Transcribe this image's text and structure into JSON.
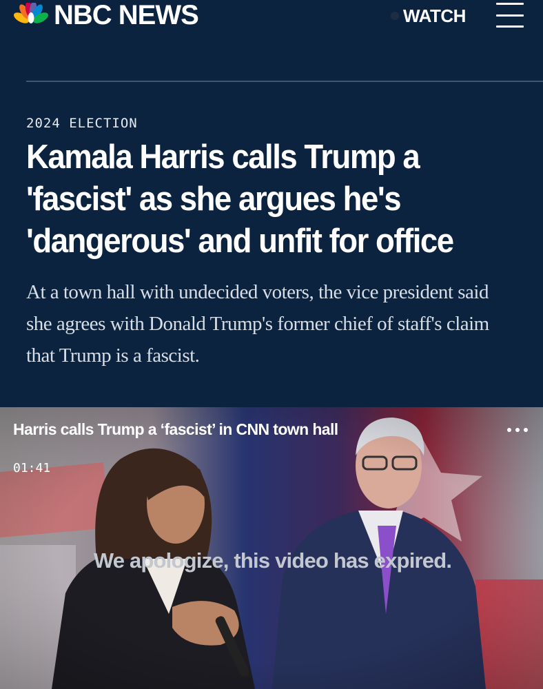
{
  "header": {
    "brand": "NBC NEWS",
    "watch_label": "WATCH",
    "icons": {
      "logo": "nbc-peacock-icon",
      "menu": "hamburger-menu-icon"
    }
  },
  "article": {
    "section": "2024 ELECTION",
    "headline": "Kamala Harris calls Trump a 'fascist' as she argues he's 'dangerous' and unfit for office",
    "dek": "At a town hall with undecided voters, the vice president said she agrees with Donald Trump's former chief of staff's claim that Trump is a fascist."
  },
  "video": {
    "title": "Harris calls Trump a ‘fascist’ in CNN town hall",
    "duration": "01:41",
    "message": "We apologize, this video has expired.",
    "icons": {
      "more": "more-options-icon"
    }
  },
  "colors": {
    "background": "#0c2340",
    "text": "#ffffff"
  }
}
